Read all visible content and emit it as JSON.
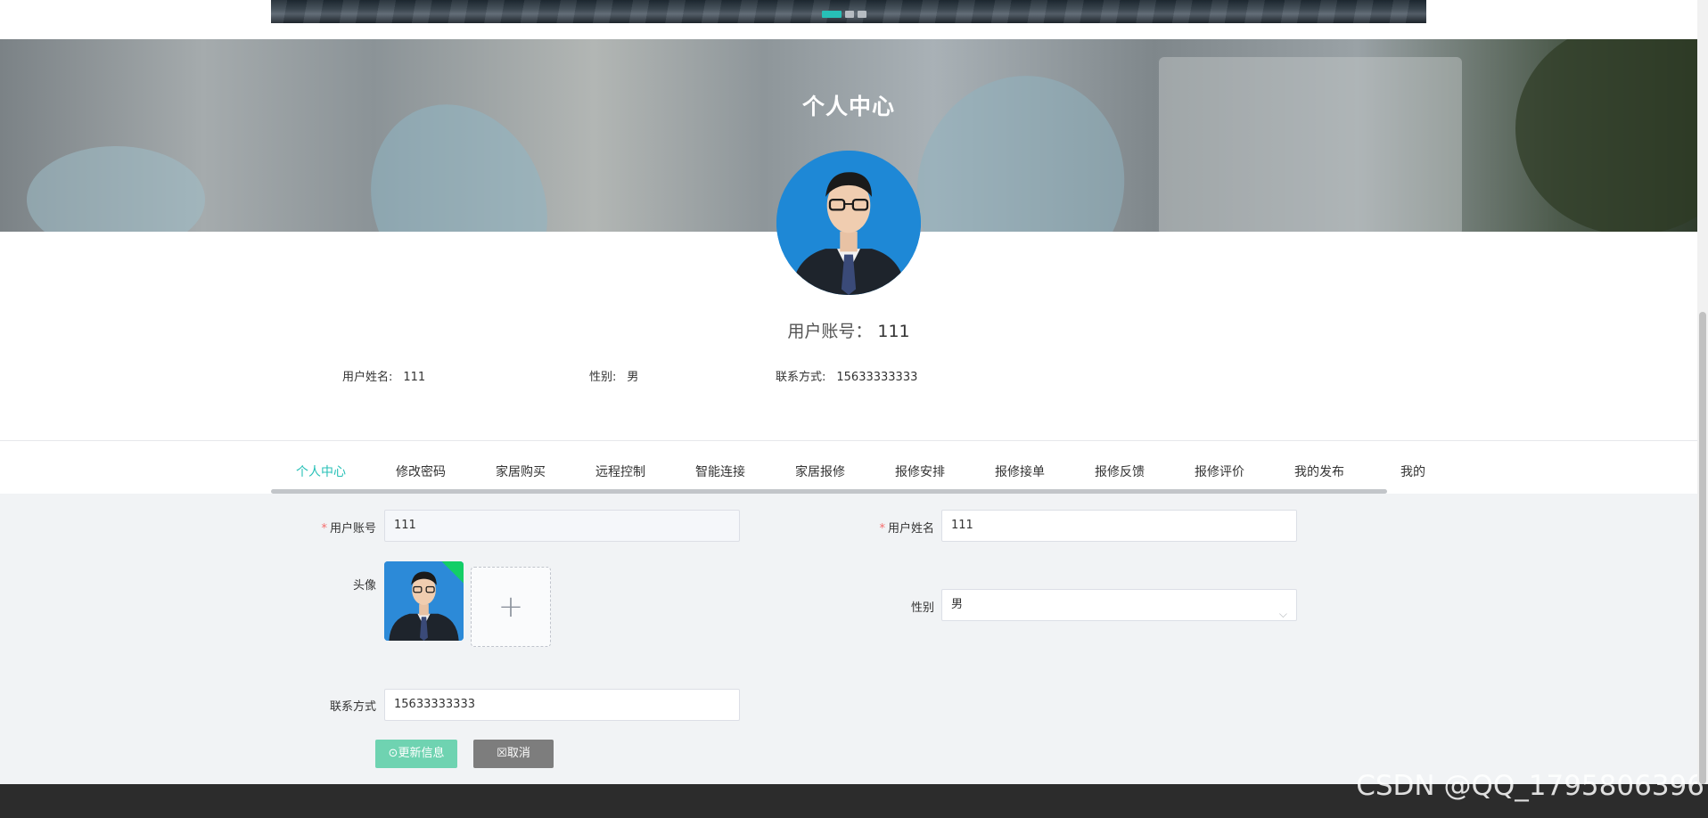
{
  "carousel": {
    "dots": 3,
    "active_dot": 0
  },
  "hero": {
    "title": "个人中心"
  },
  "profile": {
    "account_label": "用户账号：",
    "account_value": "111",
    "name_label": "用户姓名:",
    "name_value": "111",
    "gender_label": "性别:",
    "gender_value": "男",
    "phone_label": "联系方式:",
    "phone_value": "15633333333"
  },
  "tabs": [
    {
      "label": "个人中心",
      "active": true
    },
    {
      "label": "修改密码",
      "active": false
    },
    {
      "label": "家居购买",
      "active": false
    },
    {
      "label": "远程控制",
      "active": false
    },
    {
      "label": "智能连接",
      "active": false
    },
    {
      "label": "家居报修",
      "active": false
    },
    {
      "label": "报修安排",
      "active": false
    },
    {
      "label": "报修接单",
      "active": false
    },
    {
      "label": "报修反馈",
      "active": false
    },
    {
      "label": "报修评价",
      "active": false
    },
    {
      "label": "我的发布",
      "active": false
    },
    {
      "label": "我的收",
      "active": false
    }
  ],
  "form": {
    "account_label": "用户账号",
    "account_value": "111",
    "name_label": "用户姓名",
    "name_value": "111",
    "avatar_label": "头像",
    "gender_label": "性别",
    "gender_value": "男",
    "phone_label": "联系方式",
    "phone_value": "15633333333",
    "update_button": "⊙更新信息",
    "cancel_button": "☒取消"
  },
  "watermark": "CSDN @QQ_1795806396",
  "colors": {
    "accent": "#27c0b7",
    "primary_button": "#6fd3b1",
    "cancel_button": "#7d7d7d",
    "required": "#f56c6c"
  },
  "icons": {
    "upload": "plus-icon",
    "select": "chevron-down-icon"
  }
}
